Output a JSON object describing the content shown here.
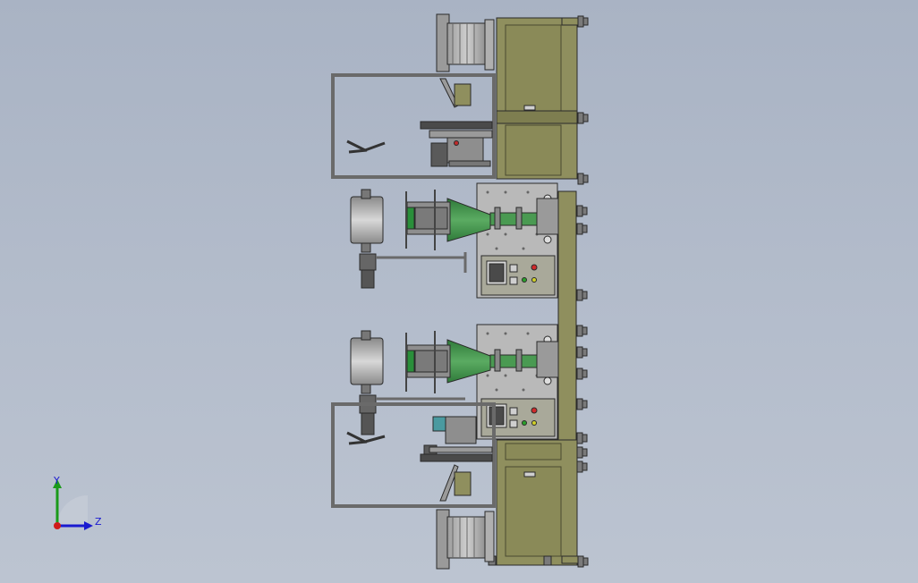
{
  "viewport": {
    "background_top": "#a9b3c4",
    "background_bottom": "#bcc4d1"
  },
  "colors": {
    "frame_olive": "#8f8f5e",
    "frame_olive_dark": "#6d6d44",
    "sheet_metal": "#b9b9b9",
    "nozzle_green": "#3f8f4a",
    "roller_gray": "#a8a8a8",
    "outline": "#2a2a2a"
  },
  "triad": {
    "x_axis_label": "Z",
    "y_axis_label": "Y",
    "x_axis_color": "#1a1ad0",
    "y_axis_color": "#1a9a1a",
    "origin_color": "#d01a1a"
  }
}
